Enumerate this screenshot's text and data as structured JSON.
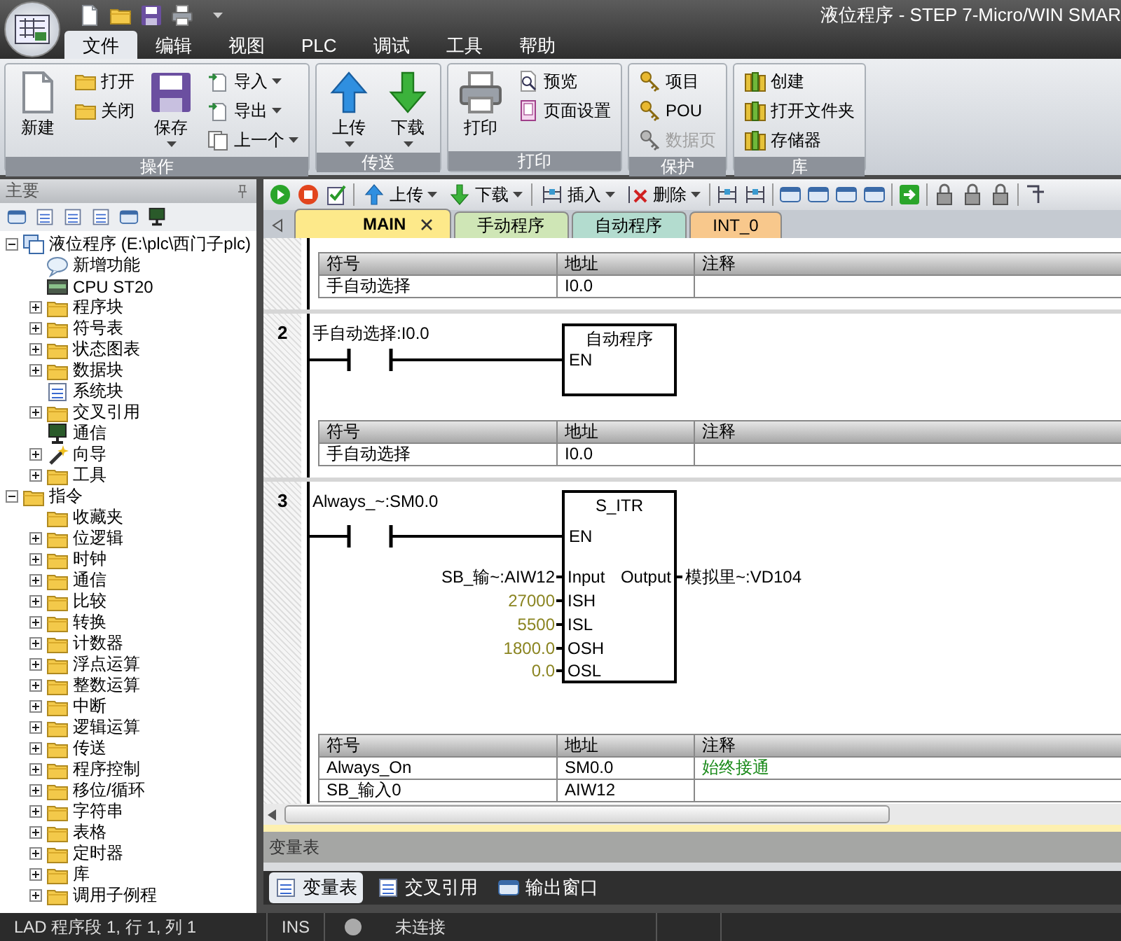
{
  "window": {
    "title": "液位程序 - STEP 7-Micro/WIN SMAR"
  },
  "ribbon_tabs": [
    {
      "label": "文件",
      "selected": true
    },
    {
      "label": "编辑",
      "selected": false
    },
    {
      "label": "视图",
      "selected": false
    },
    {
      "label": "PLC",
      "selected": false
    },
    {
      "label": "调试",
      "selected": false
    },
    {
      "label": "工具",
      "selected": false
    },
    {
      "label": "帮助",
      "selected": false
    }
  ],
  "ribbon_groups": [
    {
      "label": "操作",
      "columns": [
        [
          {
            "label": "新建",
            "kind": "large",
            "dropdown": false
          }
        ],
        [
          {
            "label": "打开",
            "kind": "small",
            "dropdown": false
          },
          {
            "label": "关闭",
            "kind": "small",
            "dropdown": false
          }
        ],
        [
          {
            "label": "保存",
            "kind": "large",
            "dropdown": true
          }
        ],
        [
          {
            "label": "导入",
            "kind": "small",
            "dropdown": true
          },
          {
            "label": "导出",
            "kind": "small",
            "dropdown": true
          },
          {
            "label": "上一个",
            "kind": "small",
            "dropdown": true
          }
        ]
      ]
    },
    {
      "label": "传送",
      "columns": [
        [
          {
            "label": "上传",
            "kind": "large",
            "dropdown": true
          }
        ],
        [
          {
            "label": "下载",
            "kind": "large",
            "dropdown": true
          }
        ]
      ]
    },
    {
      "label": "打印",
      "columns": [
        [
          {
            "label": "打印",
            "kind": "large",
            "dropdown": false
          }
        ],
        [
          {
            "label": "预览",
            "kind": "small",
            "dropdown": false
          },
          {
            "label": "页面设置",
            "kind": "small",
            "dropdown": false
          }
        ]
      ]
    },
    {
      "label": "保护",
      "columns": [
        [
          {
            "label": "项目",
            "kind": "small",
            "dropdown": false,
            "disabled": false
          },
          {
            "label": "POU",
            "kind": "small",
            "dropdown": false,
            "disabled": false
          },
          {
            "label": "数据页",
            "kind": "small",
            "dropdown": false,
            "disabled": true
          }
        ]
      ]
    },
    {
      "label": "库",
      "columns": [
        [
          {
            "label": "创建",
            "kind": "small",
            "dropdown": false
          },
          {
            "label": "打开文件夹",
            "kind": "small",
            "dropdown": false
          },
          {
            "label": "存储器",
            "kind": "small",
            "dropdown": false
          }
        ]
      ]
    }
  ],
  "project_panel": {
    "title": "主要",
    "tree": [
      {
        "label": "液位程序 (E:\\plc\\西门子plc)",
        "kind": "project",
        "expanded": true,
        "children": [
          {
            "label": "新增功能",
            "kind": "help"
          },
          {
            "label": "CPU ST20",
            "kind": "module"
          },
          {
            "label": "程序块",
            "kind": "folder",
            "expanded": false
          },
          {
            "label": "符号表",
            "kind": "folder",
            "expanded": false
          },
          {
            "label": "状态图表",
            "kind": "folder",
            "expanded": false
          },
          {
            "label": "数据块",
            "kind": "folder",
            "expanded": false
          },
          {
            "label": "系统块",
            "kind": "block"
          },
          {
            "label": "交叉引用",
            "kind": "folder",
            "expanded": false
          },
          {
            "label": "通信",
            "kind": "monitor"
          },
          {
            "label": "向导",
            "kind": "wand",
            "expanded": false
          },
          {
            "label": "工具",
            "kind": "folder",
            "expanded": false
          }
        ]
      },
      {
        "label": "指令",
        "kind": "folder",
        "expanded": true,
        "children": [
          {
            "label": "收藏夹",
            "kind": "folder"
          },
          {
            "label": "位逻辑",
            "kind": "folder",
            "expanded": false
          },
          {
            "label": "时钟",
            "kind": "folder",
            "expanded": false
          },
          {
            "label": "通信",
            "kind": "folder",
            "expanded": false
          },
          {
            "label": "比较",
            "kind": "folder",
            "expanded": false
          },
          {
            "label": "转换",
            "kind": "folder",
            "expanded": false
          },
          {
            "label": "计数器",
            "kind": "folder",
            "expanded": false
          },
          {
            "label": "浮点运算",
            "kind": "folder",
            "expanded": false
          },
          {
            "label": "整数运算",
            "kind": "folder",
            "expanded": false
          },
          {
            "label": "中断",
            "kind": "folder",
            "expanded": false
          },
          {
            "label": "逻辑运算",
            "kind": "folder",
            "expanded": false
          },
          {
            "label": "传送",
            "kind": "folder",
            "expanded": false
          },
          {
            "label": "程序控制",
            "kind": "folder",
            "expanded": false
          },
          {
            "label": "移位/循环",
            "kind": "folder",
            "expanded": false
          },
          {
            "label": "字符串",
            "kind": "folder",
            "expanded": false
          },
          {
            "label": "表格",
            "kind": "folder",
            "expanded": false
          },
          {
            "label": "定时器",
            "kind": "folder",
            "expanded": false
          },
          {
            "label": "库",
            "kind": "folder",
            "expanded": false
          },
          {
            "label": "调用子例程",
            "kind": "folder",
            "expanded": false
          }
        ]
      }
    ]
  },
  "editor_toolbar": [
    {
      "kind": "icon"
    },
    {
      "kind": "icon"
    },
    {
      "kind": "icon"
    },
    {
      "kind": "separator"
    },
    {
      "kind": "button",
      "label": "上传",
      "dropdown": true
    },
    {
      "kind": "button",
      "label": "下载",
      "dropdown": true
    },
    {
      "kind": "separator"
    },
    {
      "kind": "button",
      "label": "插入",
      "dropdown": true
    },
    {
      "kind": "button",
      "label": "删除",
      "dropdown": true
    },
    {
      "kind": "separator"
    },
    {
      "kind": "icon"
    },
    {
      "kind": "icon"
    },
    {
      "kind": "separator"
    },
    {
      "kind": "icon"
    },
    {
      "kind": "icon"
    },
    {
      "kind": "icon"
    },
    {
      "kind": "icon"
    },
    {
      "kind": "separator"
    },
    {
      "kind": "icon"
    },
    {
      "kind": "separator"
    },
    {
      "kind": "icon"
    },
    {
      "kind": "icon"
    },
    {
      "kind": "icon"
    },
    {
      "kind": "separator"
    },
    {
      "kind": "icon"
    }
  ],
  "pou_tabs": [
    {
      "label": "MAIN",
      "selected": true,
      "closable": true,
      "color": "#fde98a"
    },
    {
      "label": "手动程序",
      "selected": false,
      "closable": false,
      "color": "#cfe6b6"
    },
    {
      "label": "自动程序",
      "selected": false,
      "closable": false,
      "color": "#b3dccf"
    },
    {
      "label": "INT_0",
      "selected": false,
      "closable": false,
      "color": "#f8c88c"
    }
  ],
  "networks": [
    {
      "symbols": {
        "columns": [
          "符号",
          "地址",
          "注释"
        ],
        "rows": [
          {
            "symbol": "手自动选择",
            "address": "I0.0"
          }
        ]
      }
    },
    {
      "number": "2",
      "contact": "手自动选择:I0.0",
      "box": {
        "title": "自动程序",
        "enable": "EN"
      },
      "symbols": {
        "columns": [
          "符号",
          "地址",
          "注释"
        ],
        "rows": [
          {
            "symbol": "手自动选择",
            "address": "I0.0"
          }
        ]
      }
    },
    {
      "number": "3",
      "contact": "Always_~:SM0.0",
      "box": {
        "title": "S_ITR",
        "enable": "EN",
        "inputs": [
          {
            "pin": "Input",
            "value": "SB_输~:AIW12",
            "kind": "symbol"
          },
          {
            "pin": "ISH",
            "value": "27000",
            "kind": "constant"
          },
          {
            "pin": "ISL",
            "value": "5500",
            "kind": "constant"
          },
          {
            "pin": "OSH",
            "value": "1800.0",
            "kind": "constant"
          },
          {
            "pin": "OSL",
            "value": "0.0",
            "kind": "constant"
          }
        ],
        "outputs": [
          {
            "pin": "Output",
            "value": "模拟里~:VD104"
          }
        ]
      },
      "symbols": {
        "columns": [
          "符号",
          "地址",
          "注释"
        ],
        "rows": [
          {
            "symbol": "Always_On",
            "address": "SM0.0",
            "comment": "始终接通"
          },
          {
            "symbol": "SB_输入0",
            "address": "AIW12"
          }
        ]
      }
    }
  ],
  "output_panel": {
    "title": "变量表",
    "tabs": [
      {
        "label": "变量表",
        "selected": true
      },
      {
        "label": "交叉引用",
        "selected": false
      },
      {
        "label": "输出窗口",
        "selected": false
      }
    ]
  },
  "status_bar": {
    "position": "LAD 程序段 1, 行 1, 列 1",
    "mode": "INS",
    "connection": "未连接"
  }
}
